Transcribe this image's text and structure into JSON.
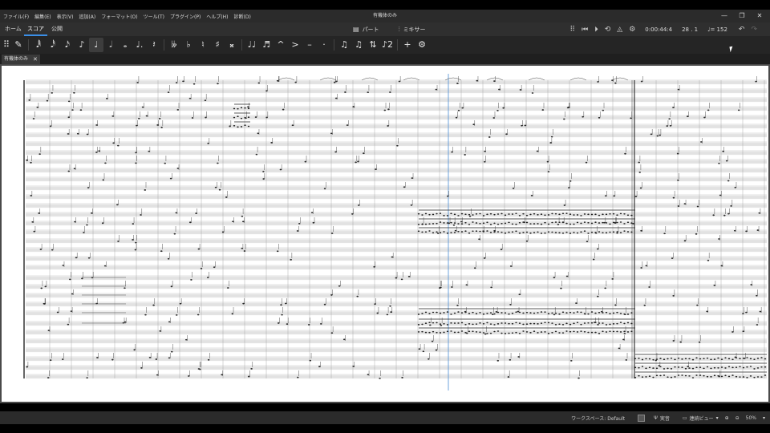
{
  "window": {
    "title": "有機体のみ",
    "menu": [
      "ファイル(F)",
      "編集(E)",
      "表示(V)",
      "追加(A)",
      "フォーマット(O)",
      "ツール(T)",
      "プラグイン(P)",
      "ヘルプ(H)",
      "診断(D)"
    ],
    "controls": {
      "minimize": "—",
      "restore": "❐",
      "close": "✕"
    }
  },
  "nav": {
    "tabs": [
      {
        "label": "ホーム",
        "active": false
      },
      {
        "label": "スコア",
        "active": true
      },
      {
        "label": "公開",
        "active": false
      }
    ],
    "center": [
      {
        "icon": "parts-icon",
        "glyph": "▤",
        "label": "パート"
      },
      {
        "icon": "mixer-icon",
        "glyph": "⫶",
        "label": "ミキサー"
      }
    ]
  },
  "playback": {
    "time": "0:00:44:4",
    "position": "28 . 1",
    "tempo": "♩= 152"
  },
  "toolbar": {
    "items": [
      {
        "name": "drag-handle-icon",
        "glyph": "⠿"
      },
      {
        "name": "note-input-pen-icon",
        "glyph": "✎"
      },
      {
        "name": "64th-note-icon",
        "glyph": "𝅘𝅥𝅱"
      },
      {
        "name": "32nd-note-icon",
        "glyph": "𝅘𝅥𝅰"
      },
      {
        "name": "16th-note-icon",
        "glyph": "𝅘𝅥𝅯"
      },
      {
        "name": "eighth-note-icon",
        "glyph": "♪"
      },
      {
        "name": "quarter-note-icon",
        "glyph": "♩",
        "selected": true
      },
      {
        "name": "half-note-icon",
        "glyph": "𝅗𝅥"
      },
      {
        "name": "whole-note-icon",
        "glyph": "𝅝"
      },
      {
        "name": "augmentation-dot-icon",
        "glyph": "♩."
      },
      {
        "name": "rest-icon",
        "glyph": "𝄽"
      },
      {
        "name": "double-flat-icon",
        "glyph": "𝄫"
      },
      {
        "name": "flat-icon",
        "glyph": "♭"
      },
      {
        "name": "natural-icon",
        "glyph": "♮"
      },
      {
        "name": "sharp-icon",
        "glyph": "♯"
      },
      {
        "name": "double-sharp-icon",
        "glyph": "𝄪"
      },
      {
        "name": "tie-icon",
        "glyph": "♩♩"
      },
      {
        "name": "slur-icon",
        "glyph": "♬"
      },
      {
        "name": "marcato-icon",
        "glyph": "^"
      },
      {
        "name": "accent-icon",
        "glyph": ">"
      },
      {
        "name": "tenuto-icon",
        "glyph": "–"
      },
      {
        "name": "staccato-icon",
        "glyph": "·"
      },
      {
        "name": "tuplet-icon",
        "glyph": "♫"
      },
      {
        "name": "beam-icon",
        "glyph": "♫"
      },
      {
        "name": "flip-direction-icon",
        "glyph": "⇅"
      },
      {
        "name": "voice-icon",
        "glyph": "♪2"
      },
      {
        "name": "add-icon",
        "glyph": "+"
      },
      {
        "name": "toolbar-settings-icon",
        "glyph": "⚙"
      }
    ]
  },
  "document_tab": {
    "label": "有機体のみ",
    "close": "✕"
  },
  "status": {
    "workspace": "ワークスペース: Default",
    "concert_pitch": "実音",
    "view_mode": "連続ビュー",
    "zoom": "50%"
  }
}
